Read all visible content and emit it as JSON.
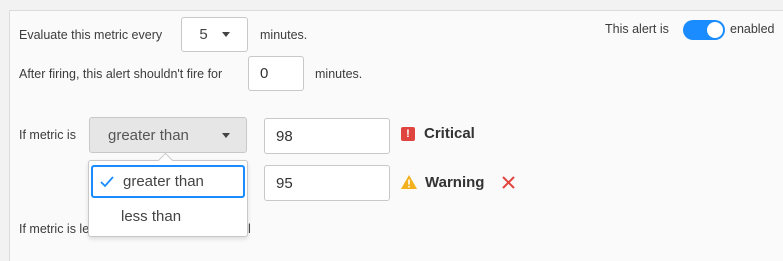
{
  "schedule": {
    "evaluate_prefix": "Evaluate this metric every",
    "interval_value": "5",
    "interval_suffix": "minutes.",
    "after_firing_prefix": "After firing, this alert shouldn't fire for",
    "cooldown_value": "0",
    "cooldown_suffix": "minutes."
  },
  "alert_toggle": {
    "label": "This alert is",
    "state_label": "enabled",
    "enabled": true,
    "color": "#1a8cff"
  },
  "condition": {
    "prefix": "If metric is",
    "comparator": "greater than",
    "critical_threshold": "98",
    "critical_label": "Critical",
    "warning_threshold": "95",
    "warning_label": "Warning",
    "critical_color": "#e0443e",
    "warning_color": "#f2b01e",
    "remove_color": "#e0443e"
  },
  "comparator_dropdown": {
    "options": [
      "greater than",
      "less than"
    ],
    "selected": "greater than",
    "accent": "#1a8cff"
  },
  "partial_row": {
    "prefix_fragment": "If metric is le",
    "suffix_fragment": "l"
  }
}
